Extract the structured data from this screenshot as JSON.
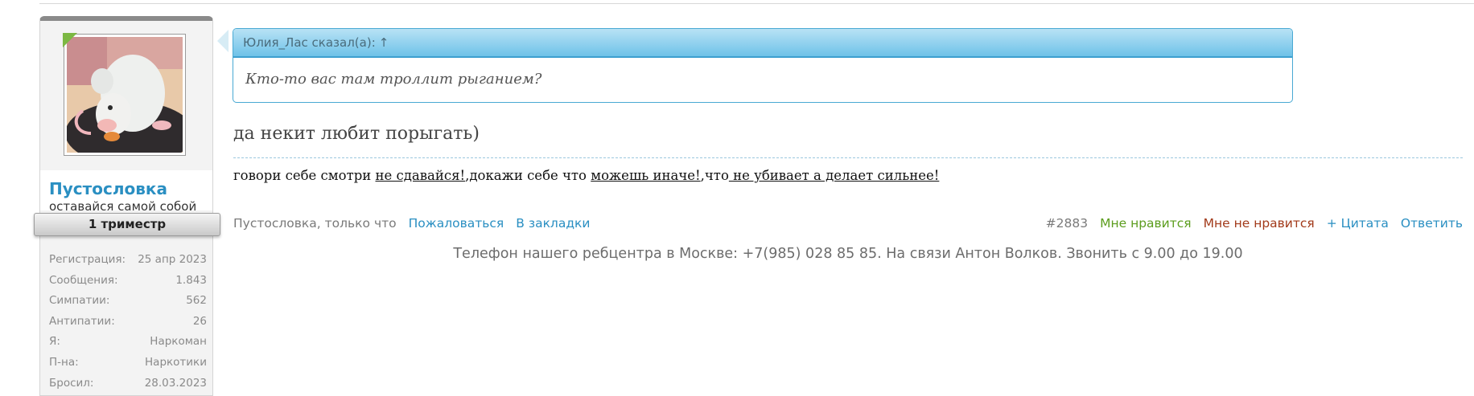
{
  "user": {
    "name": "Пустословка",
    "title": "оставайся самой собой",
    "rank": "1 триместр",
    "stats": [
      {
        "label": "Регистрация:",
        "value": "25 апр 2023"
      },
      {
        "label": "Сообщения:",
        "value": "1.843"
      },
      {
        "label": "Симпатии:",
        "value": "562"
      },
      {
        "label": "Антипатии:",
        "value": "26"
      },
      {
        "label": "Я:",
        "value": "Наркоман"
      },
      {
        "label": "П-на:",
        "value": "Наркотики"
      },
      {
        "label": "Бросил:",
        "value": "28.03.2023"
      }
    ]
  },
  "quote": {
    "header": "Юлия_Лас сказал(а):",
    "arrow": "↑",
    "text": "Кто-то вас там троллит рыганием?"
  },
  "message": "да некит любит порыгать)",
  "signature": {
    "p1": "говори себе смотри ",
    "u1": "не сдавайся!",
    "p2": ",докажи себе что ",
    "u2": "можешь иначе!",
    "p3": ",что",
    "u3": " не убивает а делает сильнее!"
  },
  "footer": {
    "author": "Пустословка, только что",
    "report": "Пожаловаться",
    "bookmark": "В закладки",
    "post_number": "#2883",
    "like": "Мне нравится",
    "dislike": "Мне не нравится",
    "quote": "+ Цитата",
    "reply": "Ответить"
  },
  "phone_note": "Телефон нашего ребцентра в Москве: +7(985) 028 85 85. На связи Антон Волков. Звонить с 9.00 до 19.00",
  "colors": {
    "accent": "#2a8fc2",
    "like": "#5c9d1e",
    "dislike": "#a23a1a"
  }
}
